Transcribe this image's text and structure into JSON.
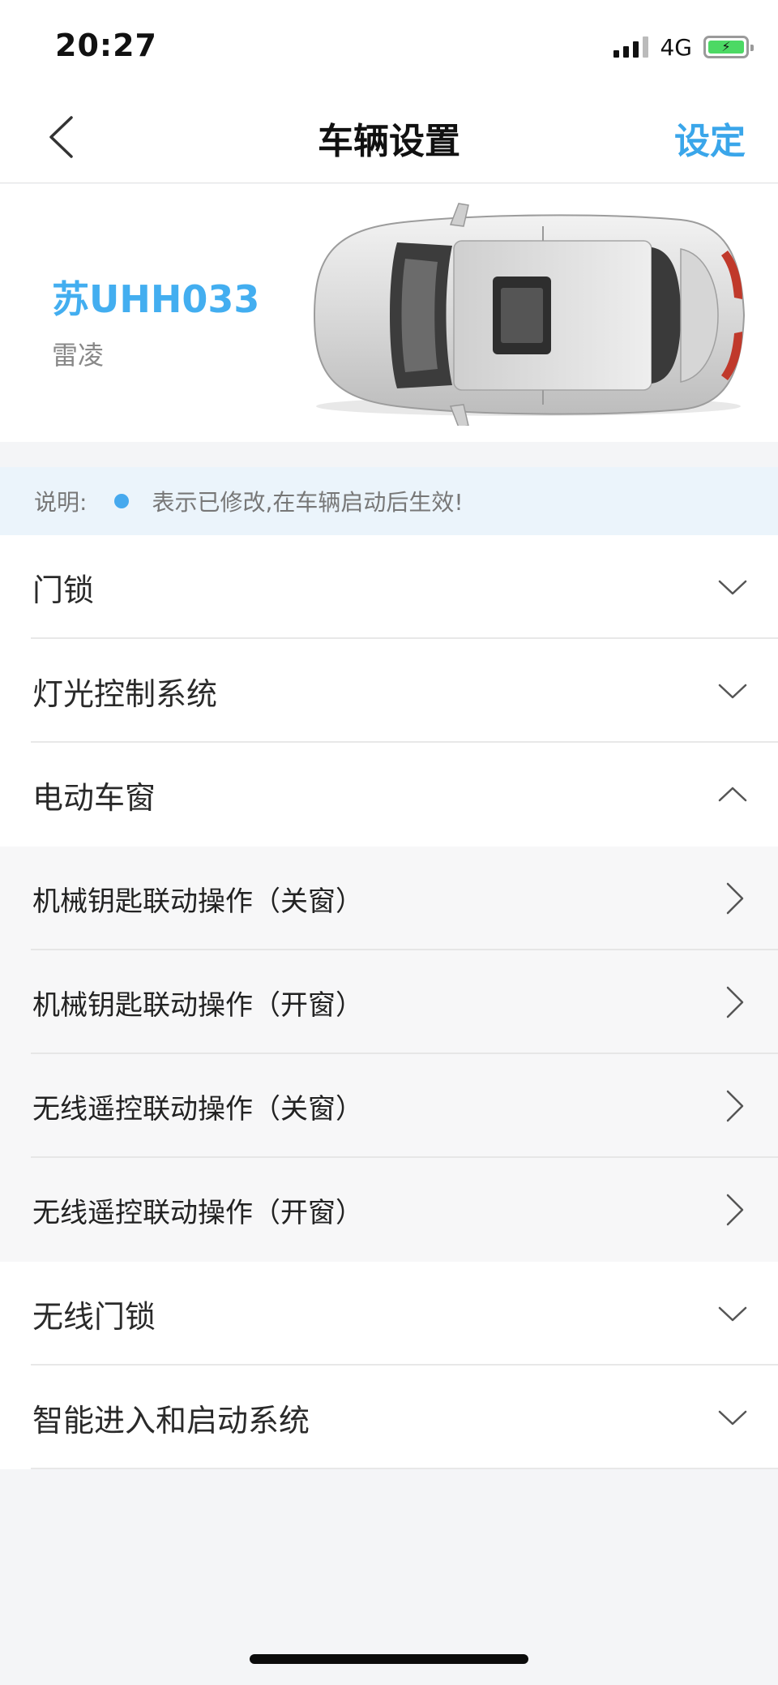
{
  "status_bar": {
    "time": "20:27",
    "network": "4G",
    "battery_charging": true
  },
  "nav": {
    "title": "车辆设置",
    "action_label": "设定",
    "back_icon": "chevron-left-icon"
  },
  "vehicle": {
    "plate": "苏UHH033",
    "model": "雷凌",
    "image": "car-top-view"
  },
  "note": {
    "label": "说明:",
    "text": "表示已修改,在车辆启动后生效!",
    "dot_color": "#46a9ee"
  },
  "sections": [
    {
      "label": "门锁",
      "expanded": false
    },
    {
      "label": "灯光控制系统",
      "expanded": false
    },
    {
      "label": "电动车窗",
      "expanded": true,
      "items": [
        {
          "label": "机械钥匙联动操作（关窗）"
        },
        {
          "label": "机械钥匙联动操作（开窗）"
        },
        {
          "label": "无线遥控联动操作（关窗）"
        },
        {
          "label": "无线遥控联动操作（开窗）"
        }
      ]
    },
    {
      "label": "无线门锁",
      "expanded": false
    },
    {
      "label": "智能进入和启动系统",
      "expanded": false
    }
  ],
  "colors": {
    "accent": "#3aa6ea",
    "plate": "#43aef0",
    "note_background": "#ebf4fb"
  }
}
